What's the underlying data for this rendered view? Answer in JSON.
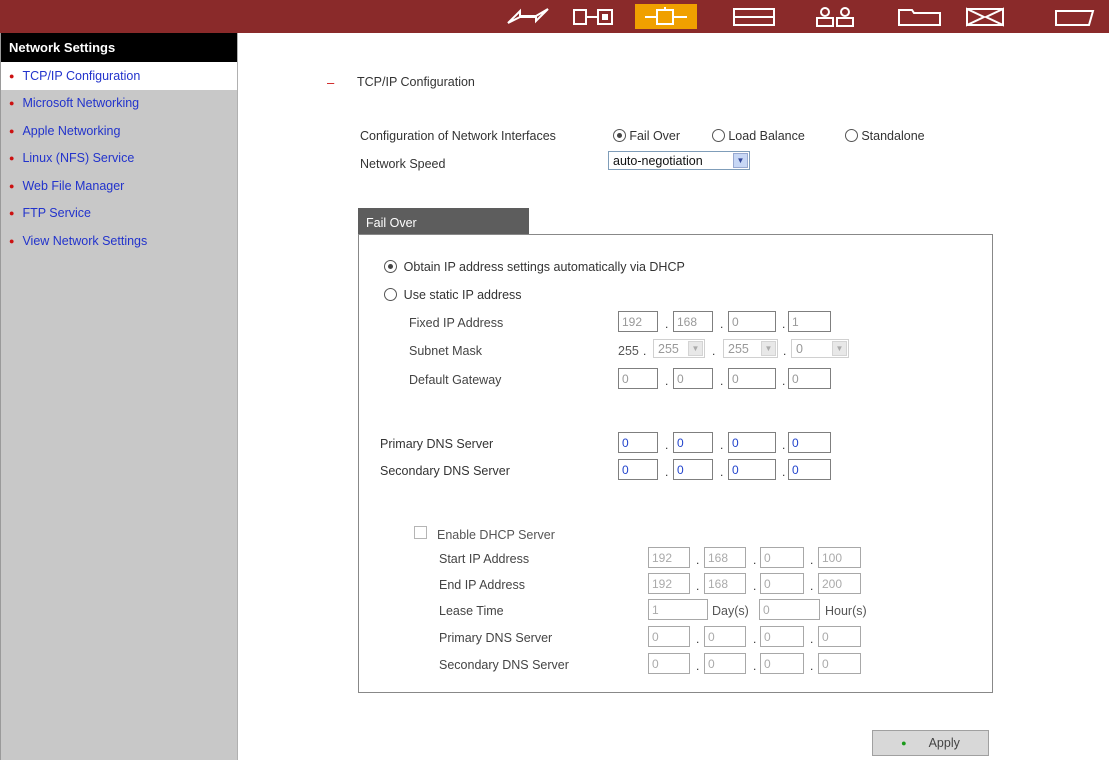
{
  "topbar": {
    "icons": [
      "quick-config-icon",
      "system-settings-icon",
      "network-settings-icon",
      "device-config-icon",
      "user-management-icon",
      "share-management-icon",
      "system-tools-icon",
      "logs-icon"
    ]
  },
  "sidebar": {
    "title": "Network Settings",
    "items": [
      {
        "label": "TCP/IP Configuration"
      },
      {
        "label": "Microsoft Networking"
      },
      {
        "label": "Apple Networking"
      },
      {
        "label": "Linux (NFS) Service"
      },
      {
        "label": "Web File Manager"
      },
      {
        "label": "FTP Service"
      },
      {
        "label": "View Network Settings"
      }
    ]
  },
  "main": {
    "dash": "–",
    "heading": "TCP/IP Configuration",
    "config_label": "Configuration of Network Interfaces",
    "config_options": [
      "Fail Over",
      "Load Balance",
      "Standalone"
    ],
    "config_selected": "Fail Over",
    "speed_label": "Network Speed",
    "speed_value": "auto-negotiation",
    "tab_label": "Fail Over",
    "dhcp_option": "Obtain IP address settings automatically via DHCP",
    "static_option": "Use static IP address",
    "fixed_ip_label": "Fixed IP Address",
    "fixed_ip": [
      "192",
      "168",
      "0",
      "1"
    ],
    "subnet_label": "Subnet Mask",
    "subnet": [
      "255",
      "255",
      "255",
      "0"
    ],
    "gateway_label": "Default Gateway",
    "gateway": [
      "0",
      "0",
      "0",
      "0"
    ],
    "primary_dns_label": "Primary DNS Server",
    "primary_dns": [
      "0",
      "0",
      "0",
      "0"
    ],
    "secondary_dns_label": "Secondary DNS Server",
    "secondary_dns": [
      "0",
      "0",
      "0",
      "0"
    ],
    "dhcp_server": {
      "enable_label": "Enable DHCP Server",
      "start_label": "Start IP Address",
      "start": [
        "192",
        "168",
        "0",
        "100"
      ],
      "end_label": "End IP Address",
      "end": [
        "192",
        "168",
        "0",
        "200"
      ],
      "lease_label": "Lease Time",
      "lease_days": "1",
      "days_unit": "Day(s)",
      "lease_hours": "0",
      "hours_unit": "Hour(s)",
      "primary_dns_label": "Primary DNS Server",
      "primary_dns": [
        "0",
        "0",
        "0",
        "0"
      ],
      "secondary_dns_label": "Secondary DNS Server",
      "secondary_dns": [
        "0",
        "0",
        "0",
        "0"
      ]
    },
    "apply_label": "Apply"
  },
  "colors": {
    "topbar": "#8a2a2a",
    "active_icon": "#f0a000",
    "sidebar": "#c8c8c8",
    "link": "#2233cc",
    "bullet": "#cc1111"
  }
}
